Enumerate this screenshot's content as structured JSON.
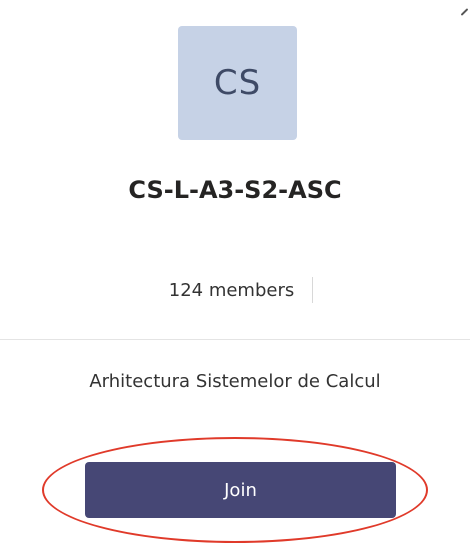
{
  "team": {
    "initials": "CS",
    "name": "CS-L-A3-S2-ASC",
    "members": "124 members",
    "description": "Arhitectura Sistemelor de Calcul"
  },
  "actions": {
    "join_label": "Join"
  },
  "colors": {
    "avatar_bg": "#c6d2e6",
    "avatar_text": "#3e4a66",
    "join_button_bg": "#464775",
    "annotation_ellipse": "#e03a2a"
  }
}
